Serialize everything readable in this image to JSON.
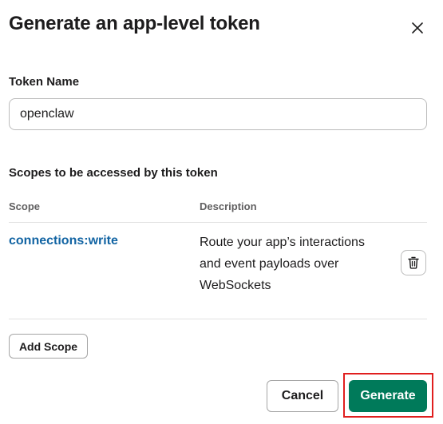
{
  "dialog": {
    "title": "Generate an app-level token",
    "close_icon": "close-icon"
  },
  "token_name": {
    "label": "Token Name",
    "value": "openclaw"
  },
  "scopes": {
    "heading": "Scopes to be accessed by this token",
    "columns": {
      "scope": "Scope",
      "description": "Description"
    },
    "rows": [
      {
        "name": "connections:write",
        "description": "Route your app’s interactions and event payloads over WebSockets",
        "remove_icon": "trash-icon"
      }
    ],
    "add_label": "Add Scope"
  },
  "footer": {
    "cancel_label": "Cancel",
    "generate_label": "Generate"
  },
  "colors": {
    "primary": "#007a5a",
    "link": "#1264a3",
    "highlight": "#e01e1e"
  }
}
